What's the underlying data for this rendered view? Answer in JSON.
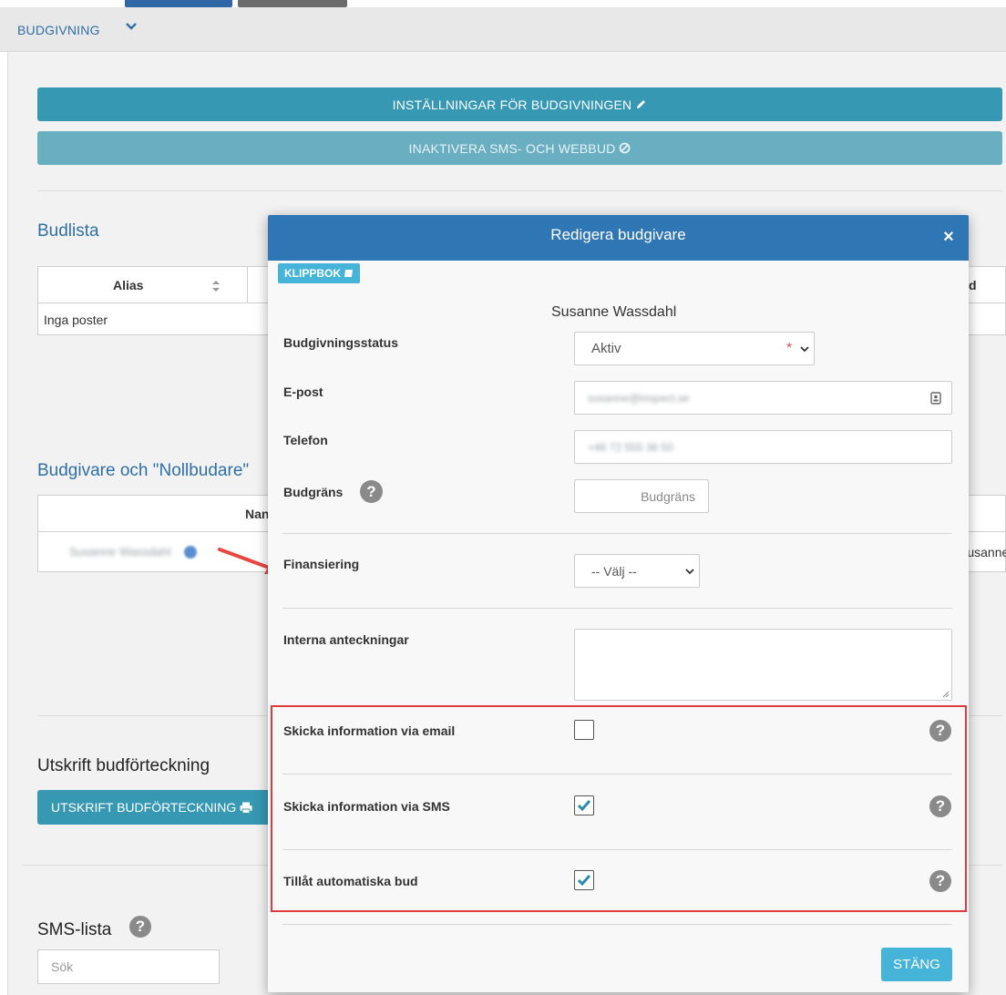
{
  "tab": {
    "title": "BUDGIVNING"
  },
  "buttons": {
    "settings": "INSTÄLLNINGAR FÖR BUDGIVNINGEN",
    "disable_sms_web": "INAKTIVERA SMS- OCH WEBBUD",
    "print_list": "UTSKRIFT BUDFÖRTECKNING"
  },
  "budlista": {
    "title": "Budlista",
    "columns": [
      "Alias"
    ],
    "right_column_fragment": "d",
    "empty_text": "Inga poster"
  },
  "budgivare": {
    "title": "Budgivare och \"Nollbudare\"",
    "columns": [
      "Nan"
    ],
    "row_name": "Susanne Wassdahl",
    "right_fragment": "Susanne"
  },
  "utskrift": {
    "title": "Utskrift budförteckning"
  },
  "sms": {
    "title": "SMS-lista",
    "search_placeholder": "Sök"
  },
  "modal": {
    "title": "Redigera budgivare",
    "close": "×",
    "klippbok": "KLIPPBOK",
    "bidder_name": "Susanne Wassdahl",
    "fields": {
      "status": {
        "label": "Budgivningsstatus",
        "value": "Aktiv",
        "required": "*"
      },
      "email": {
        "label": "E-post",
        "value": "susanne@inspect.se"
      },
      "phone": {
        "label": "Telefon",
        "value": "+46 72 555 36 50"
      },
      "limit": {
        "label": "Budgräns",
        "placeholder": "Budgräns"
      },
      "financing": {
        "label": "Finansiering",
        "value": "-- Välj --"
      },
      "notes": {
        "label": "Interna anteckningar",
        "value": ""
      }
    },
    "checkboxes": [
      {
        "label": "Skicka information via email",
        "checked": false
      },
      {
        "label": "Skicka information via SMS",
        "checked": true
      },
      {
        "label": "Tillåt automatiska bud",
        "checked": true
      }
    ],
    "close_button": "STÄNG"
  },
  "colors": {
    "primary_button": "#3798b3",
    "header_blue": "#2f76b5",
    "link_blue": "#2f6fa7",
    "highlight_red": "#e0393e",
    "annotation_arrow": "#e8473f",
    "checkmark": "#2b8ab0"
  }
}
